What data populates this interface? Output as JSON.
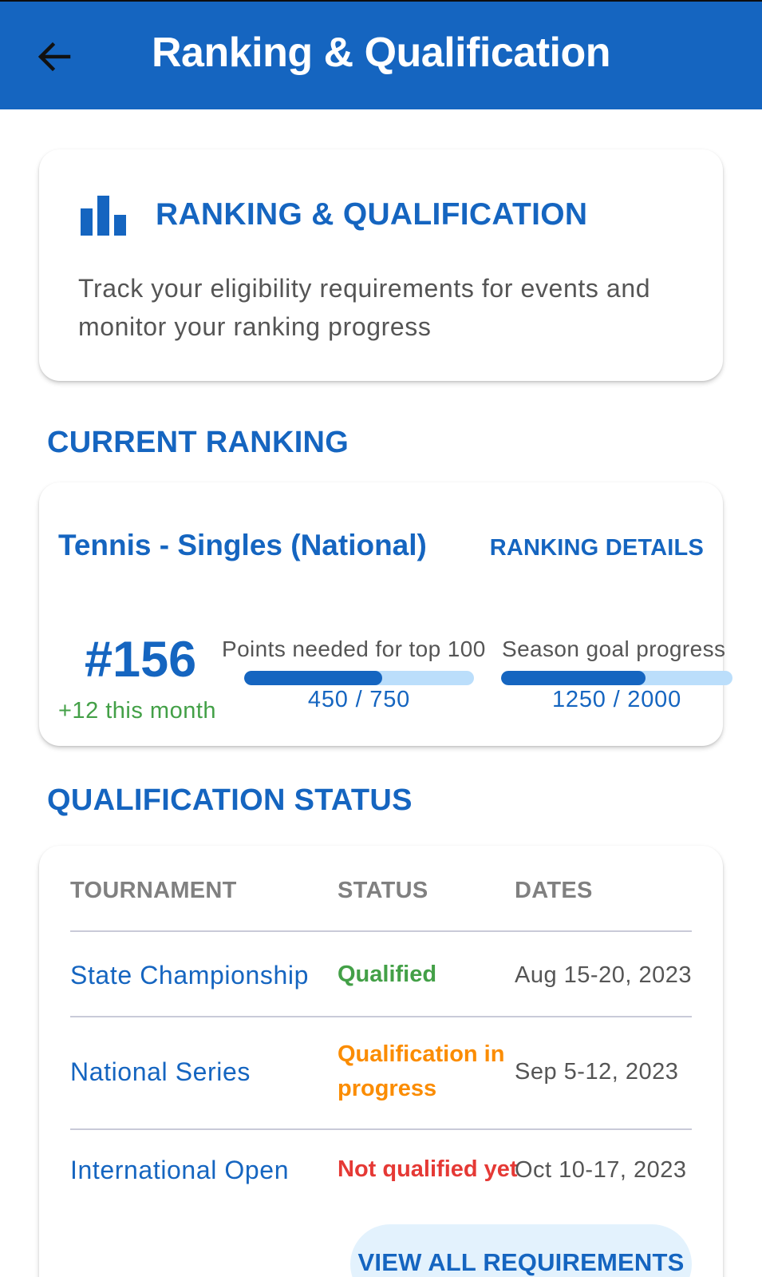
{
  "appbar": {
    "title": "Ranking & Qualification",
    "back_icon": "arrow-left-icon",
    "color": "#1565c0"
  },
  "intro": {
    "icon": "bar-chart-icon",
    "title": "RANKING & QUALIFICATION",
    "description": "Track your eligibility requirements for events and monitor your ranking progress"
  },
  "current_ranking": {
    "section_label": "CURRENT RANKING",
    "sport": "Tennis - Singles (National)",
    "details_link": "RANKING DETAILS",
    "rank": "#156",
    "change": "+12 this month",
    "metrics": [
      {
        "label": "Points needed for top 100",
        "value_text": "450 / 750",
        "current": 450,
        "total": 750
      },
      {
        "label": "Season goal progress",
        "value_text": "1250 / 2000",
        "current": 1250,
        "total": 2000
      }
    ]
  },
  "qualification": {
    "section_label": "QUALIFICATION STATUS",
    "columns": [
      "TOURNAMENT",
      "STATUS",
      "DATES"
    ],
    "rows": [
      {
        "tournament": "State Championship",
        "status": "Qualified",
        "status_color": "#43a047",
        "dates": "Aug 15-20, 2023"
      },
      {
        "tournament": "National Series",
        "status": "Qualification in progress",
        "status_color": "#fb8c00",
        "dates": "Sep 5-12, 2023"
      },
      {
        "tournament": "International Open",
        "status": "Not qualified yet",
        "status_color": "#e53935",
        "dates": "Oct 10-17, 2023"
      }
    ],
    "view_all_button": "VIEW ALL REQUIREMENTS"
  }
}
